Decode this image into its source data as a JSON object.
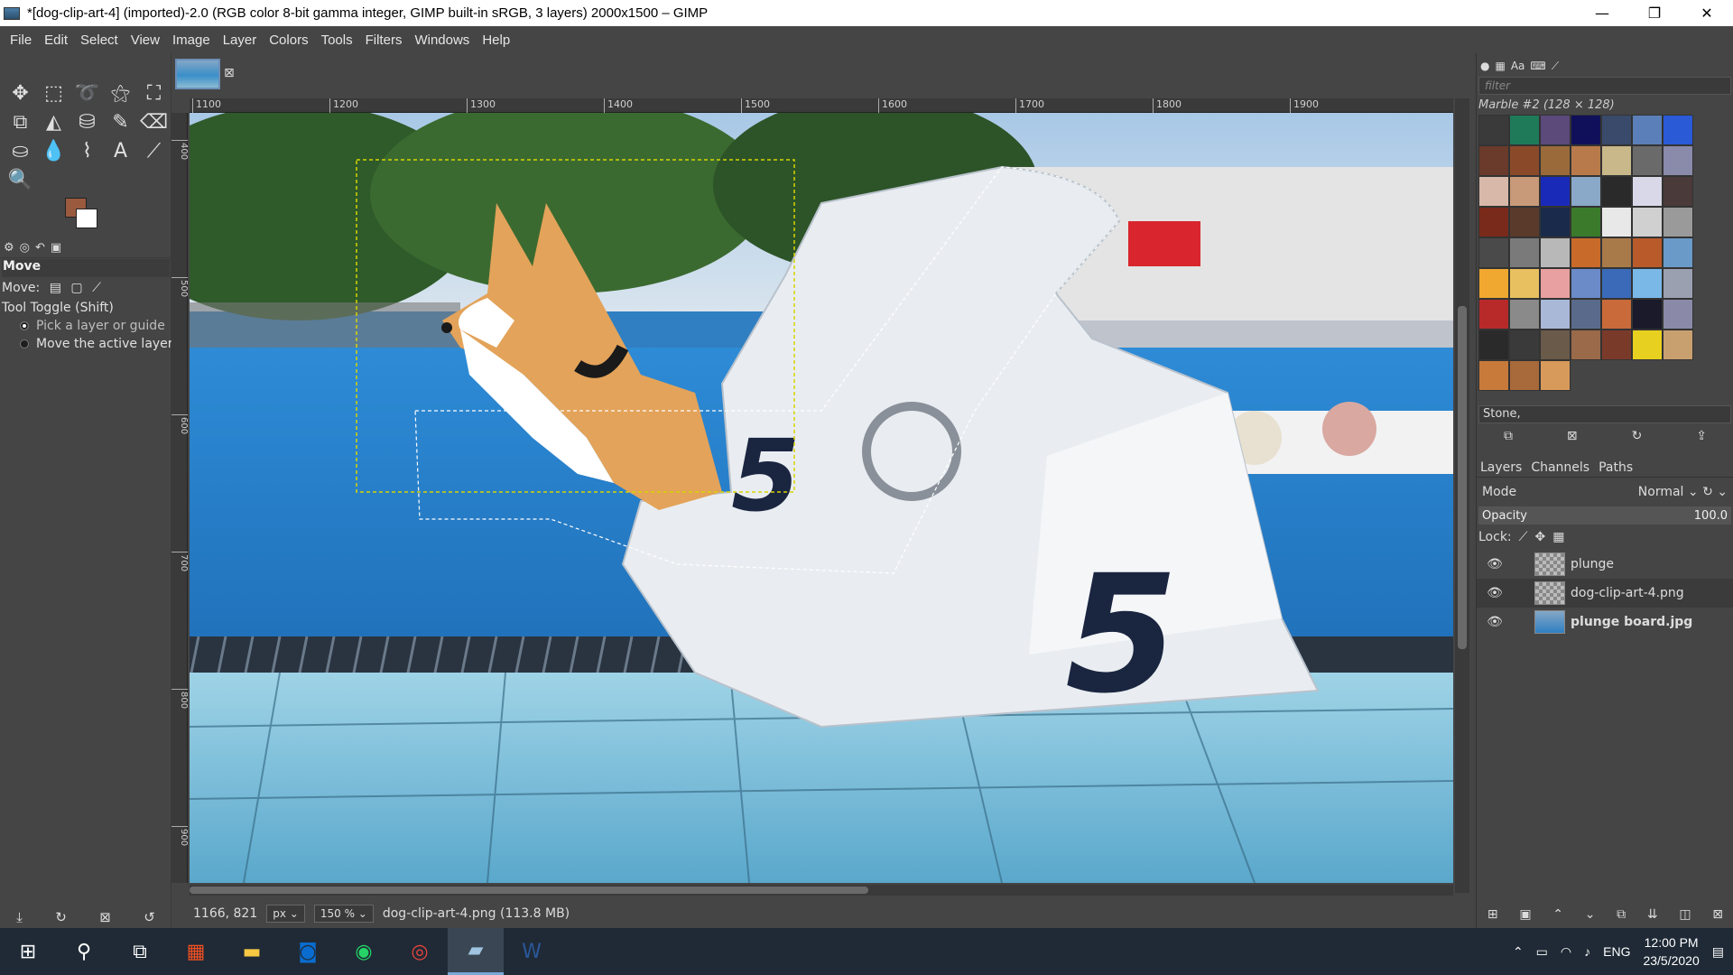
{
  "window": {
    "title": "*[dog-clip-art-4] (imported)-2.0 (RGB color 8-bit gamma integer, GIMP built-in sRGB, 3 layers) 2000x1500 – GIMP",
    "minimize": "—",
    "maximize": "❐",
    "close": "✕"
  },
  "menubar": [
    "File",
    "Edit",
    "Select",
    "View",
    "Image",
    "Layer",
    "Colors",
    "Tools",
    "Filters",
    "Windows",
    "Help"
  ],
  "toolbox": {
    "tools": [
      {
        "name": "move-tool-icon",
        "glyph": "✥"
      },
      {
        "name": "rect-select-tool-icon",
        "glyph": "⬚"
      },
      {
        "name": "lasso-tool-icon",
        "glyph": "➰"
      },
      {
        "name": "fuzzy-select-tool-icon",
        "glyph": "⚝"
      },
      {
        "name": "crop-tool-icon",
        "glyph": "⛶"
      },
      {
        "name": "transform-tool-icon",
        "glyph": "⧉"
      },
      {
        "name": "warp-tool-icon",
        "glyph": "◭"
      },
      {
        "name": "bucket-fill-tool-icon",
        "glyph": "⛁"
      },
      {
        "name": "paintbrush-tool-icon",
        "glyph": "✎"
      },
      {
        "name": "eraser-tool-icon",
        "glyph": "⌫"
      },
      {
        "name": "clone-tool-icon",
        "glyph": "⛀"
      },
      {
        "name": "smudge-tool-icon",
        "glyph": "💧"
      },
      {
        "name": "paths-tool-icon",
        "glyph": "⌇"
      },
      {
        "name": "text-tool-icon",
        "glyph": "A"
      },
      {
        "name": "color-picker-tool-icon",
        "glyph": "⟋"
      },
      {
        "name": "zoom-tool-icon",
        "glyph": "🔍"
      }
    ],
    "options_title": "Move",
    "move_label": "Move:",
    "tool_toggle": "Tool Toggle  (Shift)",
    "option_pick": "Pick a layer or guide",
    "option_active": "Move the active layer"
  },
  "ruler": {
    "h_ticks": [
      "1100",
      "1200",
      "1300",
      "1400",
      "1500",
      "1600",
      "1700",
      "1800",
      "1900"
    ],
    "v_ticks": [
      "400",
      "500",
      "600",
      "700",
      "800",
      "900"
    ]
  },
  "status": {
    "coords": "1166, 821",
    "unit": "px",
    "zoom": "150 %",
    "layer_info": "dog-clip-art-4.png (113.8 MB)"
  },
  "patterns": {
    "filter_placeholder": "filter",
    "current_label": "Marble #2 (128 × 128)",
    "tag_value": "Stone,",
    "swatches": [
      "#3a3a3a",
      "#1f7a5a",
      "#5b4a7a",
      "#10105a",
      "#3a4a6a",
      "#5b7fb8",
      "#2a5ad6",
      "#6a3a2a",
      "#8a4a2a",
      "#9a6a3a",
      "#b87a4a",
      "#c8b88a",
      "#6a6a6a",
      "#8a8aaa",
      "#d8b8a8",
      "#c89a7a",
      "#1a2ab8",
      "#8aa8c8",
      "#2a2a2a",
      "#d8d8e8",
      "#4a3a3a",
      "#7a2a1a",
      "#5a3a2a",
      "#1a2a4a",
      "#3a7a2a",
      "#e8e8e8",
      "#d0d0d0",
      "#9a9a9a",
      "#4a4a4a",
      "#7a7a7a",
      "#b8b8b8",
      "#c86a2a",
      "#a87a4a",
      "#b85a2a",
      "#6a9ac8",
      "#f0a830",
      "#e8c060",
      "#e8a0a0",
      "#6a8ac8",
      "#3a6ab8",
      "#7ab8e8",
      "#9aa0b0",
      "#b82a2a",
      "#8a8a8a",
      "#aab8d8",
      "#5a6a8a",
      "#c86a3a",
      "#1a1a2a",
      "#8a8aa8",
      "#2a2a2a",
      "#3a3a3a",
      "#6a5a4a",
      "#9a6a4a",
      "#7a3a2a",
      "#e8d020",
      "#c8a070",
      "#c87a3a",
      "#a86a3a",
      "#d89a5a"
    ]
  },
  "layers_panel": {
    "tabs": [
      "Layers",
      "Channels",
      "Paths"
    ],
    "mode_label": "Mode",
    "mode_value": "Normal",
    "opacity_label": "Opacity",
    "opacity_value": "100.0",
    "lock_label": "Lock:",
    "layers": [
      {
        "name": "plunge",
        "active": false
      },
      {
        "name": "dog-clip-art-4.png",
        "active": true
      },
      {
        "name": "plunge board.jpg",
        "active": false
      }
    ]
  },
  "taskbar": {
    "lang": "ENG",
    "time": "12:00 PM",
    "date": "23/5/2020"
  }
}
